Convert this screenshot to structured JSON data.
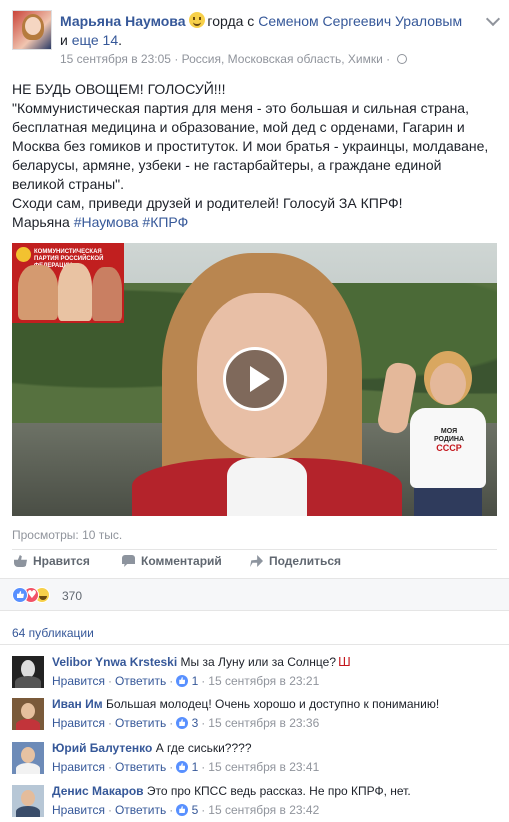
{
  "post": {
    "author": "Марьяна Наумова",
    "feeling": "горда с",
    "tagged": "Семеном Сергеевич Ураловым",
    "and": "и",
    "others": "еще 14",
    "period": ".",
    "date": "15 сентября в 23:05",
    "sep": "·",
    "location": "Россия, Московская область, Химки",
    "text": {
      "line1": "НЕ БУДЬ ОВОЩЕМ! ГОЛОСУЙ!!!",
      "quote": "\"Коммунистическая партия для меня - это большая и сильная страна, бесплатная медицина и образование, мой дед с орденами, Гагарин и Москва без гомиков и проституток. И мои братья - украинцы, молдаване, беларусы, армяне, узбеки - не гастарбайтеры, а граждане единой великой страны\".",
      "call": "Сходи сам, приведи друзей и родителей! Голосуй ЗА КПРФ!",
      "signature": "Марьяна",
      "tags": "#Наумова #КПРФ"
    }
  },
  "video": {
    "badge_title": "КОММУНИСТИЧЕСКАЯ ПАРТИЯ РОССИЙСКОЙ ФЕДЕРАЦИИ",
    "shirt_line1": "МОЯ",
    "shirt_line2": "РОДИНА",
    "shirt_line3": "СССР"
  },
  "views": "Просмотры: 10 тыс.",
  "actions": {
    "like": "Нравится",
    "comment": "Комментарий",
    "share": "Поделиться"
  },
  "reactions": {
    "count": "370"
  },
  "shares": "64 публикации",
  "comment_meta": {
    "like": "Нравится",
    "reply": "Ответить",
    "dot": "·"
  },
  "comments": [
    {
      "author": "Velibor Ynwa Krsteski",
      "text": "Мы за Луну или за Солнце?",
      "likes": "1",
      "date": "15 сентября в 23:21"
    },
    {
      "author": "Иван Им",
      "text": "Большая молодец! Очень хорошо и доступно к пониманию!",
      "likes": "3",
      "date": "15 сентября в 23:36"
    },
    {
      "author": "Юрий Балутенко",
      "text": "А где сиськи????",
      "likes": "1",
      "date": "15 сентября в 23:41"
    },
    {
      "author": "Денис Макаров",
      "text": "Это про КПСС ведь рассказ. Не про КПРФ, нет.",
      "likes": "5",
      "date": "15 сентября в 23:42"
    }
  ],
  "colors": {
    "link": "#365899",
    "meta": "#90949c",
    "like_blue": "#5890ff"
  }
}
